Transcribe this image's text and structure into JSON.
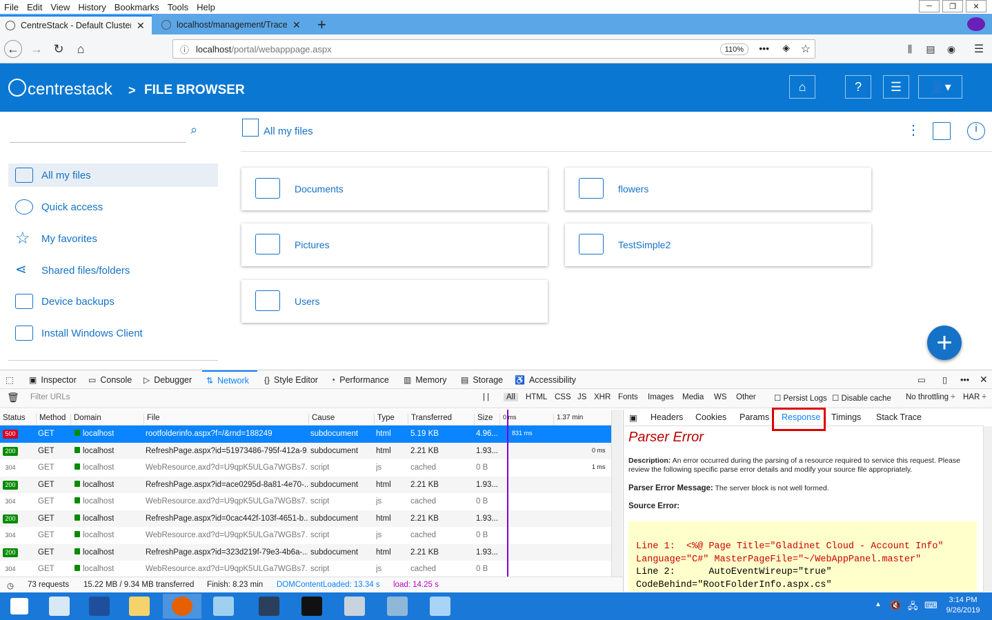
{
  "menu": [
    "File",
    "Edit",
    "View",
    "History",
    "Bookmarks",
    "Tools",
    "Help"
  ],
  "tabs": [
    {
      "title": "CentreStack - Default Cluster A"
    },
    {
      "title": "localhost/management/Trace."
    }
  ],
  "url": {
    "host": "localhost",
    "path": "/portal/webapppage.aspx",
    "zoom": "110%"
  },
  "app": {
    "logo": "centrestack",
    "crumb_sep": ">",
    "title": "FILE BROWSER"
  },
  "sidebar": {
    "items": [
      "All my files",
      "Quick access",
      "My favorites",
      "Shared files/folders",
      "Device backups",
      "Install Windows Client"
    ]
  },
  "main": {
    "breadcrumb": "All my files",
    "folders": [
      "Documents",
      "flowers",
      "Pictures",
      "TestSimple2",
      "Users"
    ]
  },
  "devtools": {
    "tabs": [
      "Inspector",
      "Console",
      "Debugger",
      "Network",
      "Style Editor",
      "Performance",
      "Memory",
      "Storage",
      "Accessibility"
    ],
    "filter_placeholder": "Filter URLs",
    "types": [
      "All",
      "HTML",
      "CSS",
      "JS",
      "XHR",
      "Fonts",
      "Images",
      "Media",
      "WS",
      "Other"
    ],
    "persist": "Persist Logs",
    "disable_cache": "Disable cache",
    "throttle": "No throttling ÷",
    "har": "HAR ÷",
    "columns": [
      "Status",
      "Method",
      "Domain",
      "File",
      "Cause",
      "Type",
      "Transferred",
      "Size"
    ],
    "timeline_labels": [
      "0 ms",
      "1.37 min"
    ],
    "rows": [
      {
        "status": "500",
        "method": "GET",
        "domain": "localhost",
        "file": "rootfolderinfo.aspx?f=/&rnd=188249",
        "cause": "subdocument",
        "type": "html",
        "transferred": "5.19 KB",
        "size": "4.96...",
        "timing": "831 ms"
      },
      {
        "status": "200",
        "method": "GET",
        "domain": "localhost",
        "file": "RefreshPage.aspx?id=51973486-795f-412a-9...",
        "cause": "subdocument",
        "type": "html",
        "transferred": "2.21 KB",
        "size": "1.93...",
        "timing": "0 ms"
      },
      {
        "status": "304",
        "method": "GET",
        "domain": "localhost",
        "file": "WebResource.axd?d=U9qpK5ULGa7WGBs7...",
        "cause": "script",
        "type": "js",
        "transferred": "cached",
        "size": "0 B",
        "timing": "1 ms"
      },
      {
        "status": "200",
        "method": "GET",
        "domain": "localhost",
        "file": "RefreshPage.aspx?id=ace0295d-8a81-4e70-...",
        "cause": "subdocument",
        "type": "html",
        "transferred": "2.21 KB",
        "size": "1.93...",
        "timing": ""
      },
      {
        "status": "304",
        "method": "GET",
        "domain": "localhost",
        "file": "WebResource.axd?d=U9qpK5ULGa7WGBs7...",
        "cause": "script",
        "type": "js",
        "transferred": "cached",
        "size": "0 B",
        "timing": ""
      },
      {
        "status": "200",
        "method": "GET",
        "domain": "localhost",
        "file": "RefreshPage.aspx?id=0cac442f-103f-4651-b...",
        "cause": "subdocument",
        "type": "html",
        "transferred": "2.21 KB",
        "size": "1.93...",
        "timing": ""
      },
      {
        "status": "304",
        "method": "GET",
        "domain": "localhost",
        "file": "WebResource.axd?d=U9qpK5ULGa7WGBs7...",
        "cause": "script",
        "type": "js",
        "transferred": "cached",
        "size": "0 B",
        "timing": ""
      },
      {
        "status": "200",
        "method": "GET",
        "domain": "localhost",
        "file": "RefreshPage.aspx?id=323d219f-79e3-4b6a-...",
        "cause": "subdocument",
        "type": "html",
        "transferred": "2.21 KB",
        "size": "1.93...",
        "timing": ""
      },
      {
        "status": "304",
        "method": "GET",
        "domain": "localhost",
        "file": "WebResource.axd?d=U9qpK5ULGa7WGBs7...",
        "cause": "script",
        "type": "js",
        "transferred": "cached",
        "size": "0 B",
        "timing": ""
      }
    ],
    "details_tabs": [
      "Headers",
      "Cookies",
      "Params",
      "Response",
      "Timings",
      "Stack Trace"
    ],
    "response": {
      "title": "Parser Error",
      "desc_label": "Description:",
      "desc": "An error occurred during the parsing of a resource required to service this request. Please review the following specific parse error details and modify your source file appropriately.",
      "msg_label": "Parser Error Message:",
      "msg": "The server block is not well formed.",
      "src_label": "Source Error:",
      "code1": "Line 1:  <%@ Page Title=\"Gladinet Cloud - Account Info\"",
      "code2": "Language=\"C#\" MasterPageFile=\"~/WebAppPanel.master\"",
      "code3": "Line 2:      AutoEventWireup=\"true\"",
      "code4": "CodeBehind=\"RootFolderInfo.aspx.cs\""
    },
    "status": {
      "requests": "73 requests",
      "size": "15.22 MB / 9.34 MB transferred",
      "finish": "Finish: 8.23 min",
      "dcl": "DOMContentLoaded: 13.34 s",
      "load": "load: 14.25 s"
    }
  },
  "clock": {
    "time": "3:14 PM",
    "date": "9/26/2019"
  },
  "colors": {
    "brand": "#0a78d2",
    "link": "#1572c7",
    "network_accent": "#0a84ff",
    "error": "#d70022"
  }
}
